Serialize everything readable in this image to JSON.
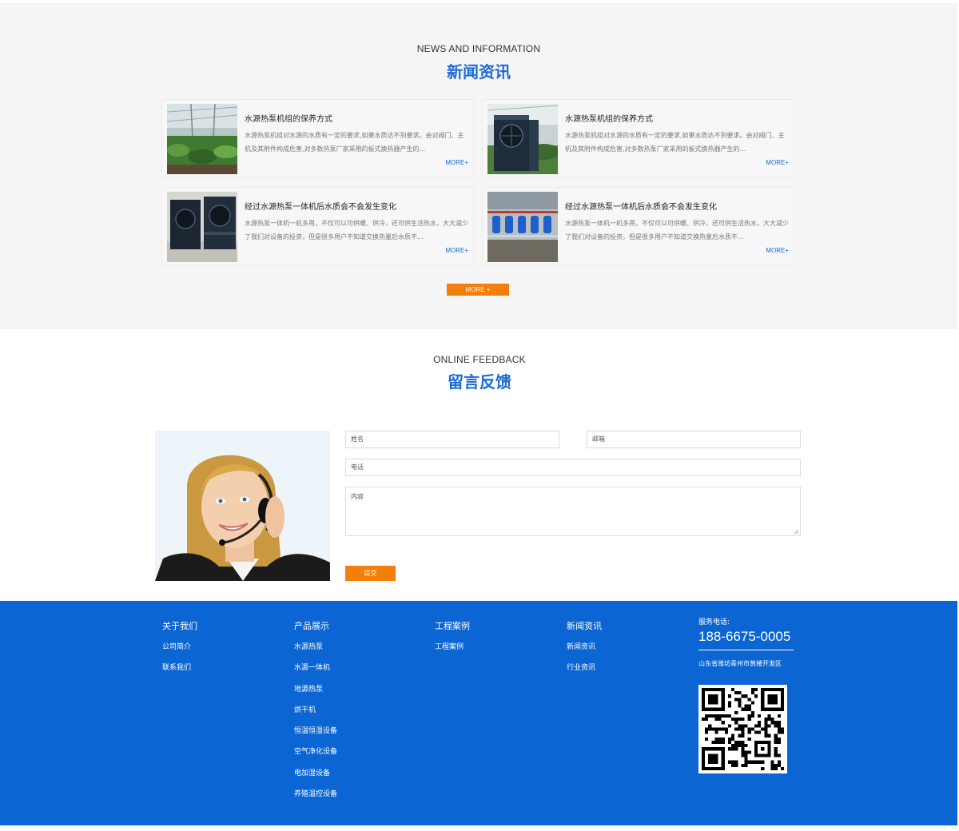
{
  "news": {
    "title_en": "NEWS AND INFORMATION",
    "title_cn": "新闻资讯",
    "items": [
      {
        "title": "水源热泵机组的保养方式",
        "desc": "水源热泵机组对水源的水质有一定的要求,如果水质达不到要求。会对阀门、主机及其附件构成危害,对多数热泵厂家采用的板式换热器产生的...",
        "more": "MORE+"
      },
      {
        "title": "水源热泵机组的保养方式",
        "desc": "水源热泵机组对水源的水质有一定的要求,如果水质达不到要求。会对阀门、主机及其附件构成危害,对多数热泵厂家采用的板式换热器产生的...",
        "more": "MORE+"
      },
      {
        "title": "经过水源热泵一体机后水质会不会发生变化",
        "desc": "水源热泵一体机一机多用，不仅可以可供暖、供冷，还可供生活热水，大大减少了我们对设备的投资，但是很多用户不知道交换热量后水质不...",
        "more": "MORE+"
      },
      {
        "title": "经过水源热泵一体机后水质会不会发生变化",
        "desc": "水源热泵一体机一机多用，不仅可以可供暖、供冷，还可供生活热水，大大减少了我们对设备的投资，但是很多用户不知道交换热量后水质不...",
        "more": "MORE+"
      }
    ],
    "more_button": "MORE +"
  },
  "feedback": {
    "title_en": "ONLINE FEEDBACK",
    "title_cn": "留言反馈",
    "name_placeholder": "姓名",
    "email_placeholder": "邮箱",
    "phone_placeholder": "电话",
    "content_placeholder": "内容",
    "submit": "提交"
  },
  "footer": {
    "columns": [
      {
        "head": "关于我们",
        "links": [
          "公司简介",
          "联系我们"
        ]
      },
      {
        "head": "产品展示",
        "links": [
          "水源热泵",
          "水源一体机",
          "地源热泵",
          "烘干机",
          "恒温恒湿设备",
          "空气净化设备",
          "电加湿设备",
          "养殖温控设备"
        ]
      },
      {
        "head": "工程案例",
        "links": [
          "工程案例"
        ]
      },
      {
        "head": "新闻资讯",
        "links": [
          "新闻资讯",
          "行业资讯"
        ]
      }
    ],
    "service_label": "服务电话:",
    "phone": "188-6675-0005",
    "address": "山东省潍坊青州市黄楼开发区"
  },
  "colors": {
    "accent_blue": "#1b6bd6",
    "footer_blue": "#0b65d2",
    "orange": "#f47e0b",
    "section_gray": "#f5f5f5"
  },
  "icons": [
    "greenhouse-photo",
    "heat-pump-photo",
    "heat-pump-units-photo",
    "pump-room-photo",
    "customer-service-photo",
    "qr-code"
  ]
}
